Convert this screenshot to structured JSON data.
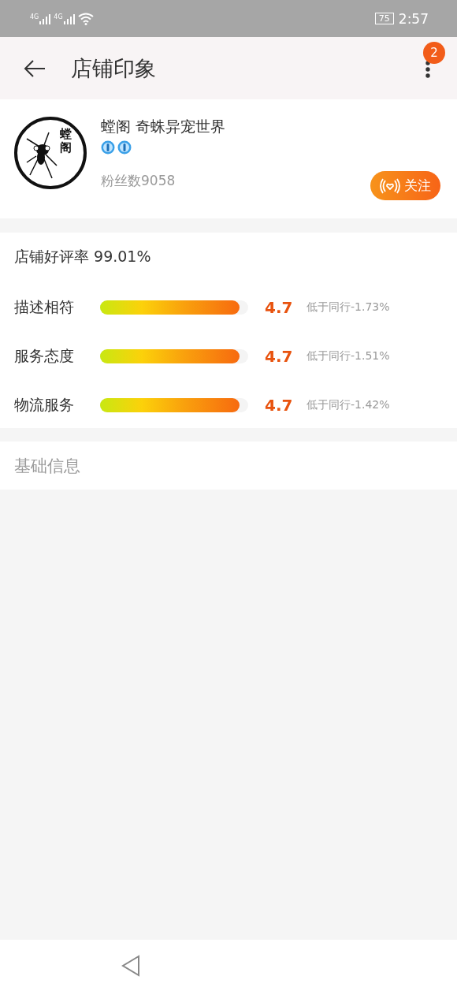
{
  "status_bar": {
    "network_labels": [
      "4G",
      "4G"
    ],
    "battery": "75",
    "time": "2:57"
  },
  "header": {
    "title": "店铺印象",
    "notification_count": "2"
  },
  "shop": {
    "logo_text": "螳阁",
    "name": "螳阁 奇蛛异宠世界",
    "badges": [
      {
        "kind": "crown"
      },
      {
        "kind": "crown"
      }
    ],
    "fans": "粉丝数9058",
    "follow_button": "关注"
  },
  "ratings": {
    "summary": "店铺好评率 99.01%",
    "items": [
      {
        "label": "描述相符",
        "level": 0.94,
        "score": "4.7",
        "comparison": "低于同行-1.73%"
      },
      {
        "label": "服务态度",
        "level": 0.94,
        "score": "4.7",
        "comparison": "低于同行-1.51%"
      },
      {
        "label": "物流服务",
        "level": 0.94,
        "score": "4.7",
        "comparison": "低于同行-1.42%"
      }
    ]
  },
  "basic_info": {
    "title": "基础信息"
  }
}
